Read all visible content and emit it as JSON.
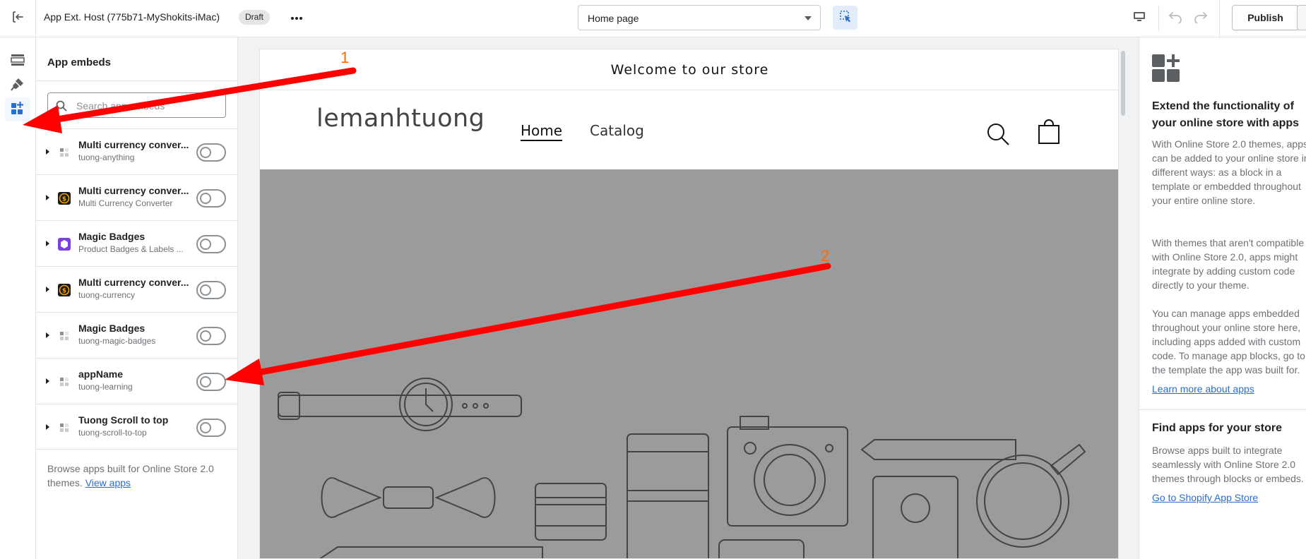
{
  "topbar": {
    "app_title": "App Ext. Host (775b71-MyShokits-iMac)",
    "draft_badge": "Draft",
    "page_select_value": "Home page",
    "publish_label": "Publish"
  },
  "sidebar": {
    "title": "App embeds",
    "search_placeholder": "Search app embeds",
    "items": [
      {
        "name": "Multi currency conver...",
        "sub": "tuong-anything",
        "icon": "generic-app-icon",
        "enabled": false
      },
      {
        "name": "Multi currency conver...",
        "sub": "Multi Currency Converter",
        "icon": "currency-app-icon",
        "enabled": false
      },
      {
        "name": "Magic Badges",
        "sub": "Product Badges & Labels ...",
        "icon": "badges-app-icon",
        "enabled": false
      },
      {
        "name": "Multi currency conver...",
        "sub": "tuong-currency",
        "icon": "currency-app-icon",
        "enabled": false
      },
      {
        "name": "Magic Badges",
        "sub": "tuong-magic-badges",
        "icon": "generic-app-icon",
        "enabled": false
      },
      {
        "name": "appName",
        "sub": "tuong-learning",
        "icon": "generic-app-icon",
        "enabled": false
      },
      {
        "name": "Tuong Scroll to top",
        "sub": "tuong-scroll-to-top",
        "icon": "generic-app-icon",
        "enabled": false
      }
    ],
    "footer_text": "Browse apps built for Online Store 2.0 themes.",
    "footer_link": "View apps"
  },
  "preview": {
    "announcement": "Welcome to our store",
    "store_name": "lemanhtuong",
    "nav": [
      "Home",
      "Catalog"
    ]
  },
  "right_panel": {
    "heading": "Extend the functionality of your online store with apps",
    "para1": "With Online Store 2.0 themes, apps can be added to your online store in different ways: as a block in a template or embedded throughout your entire online store.",
    "para2": "With themes that aren't compatible with Online Store 2.0, apps might integrate by adding custom code directly to your theme.",
    "para3": "You can manage apps embedded throughout your online store here, including apps added with custom code. To manage app blocks, go to the template the app was built for.",
    "link1": "Learn more about apps",
    "heading2": "Find apps for your store",
    "para4": "Browse apps built to integrate seamlessly with Online Store 2.0 themes through blocks or embeds.",
    "link2": "Go to Shopify App Store"
  },
  "annotations": {
    "label1": "1",
    "label2": "2",
    "arrow_color": "#ff0000",
    "label_color": "#ff6a00"
  },
  "colors": {
    "accent": "#2c6ecb",
    "hero_bg": "#9b9b9b"
  }
}
